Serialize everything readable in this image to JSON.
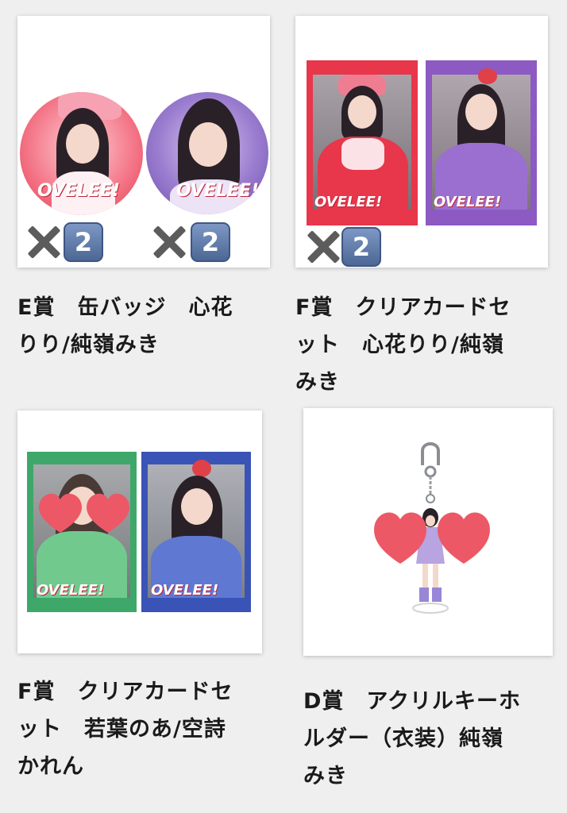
{
  "items": [
    {
      "caption_line1": "E賞　缶バッジ　心花",
      "caption_line2": "りり/純嶺みき",
      "qty_left": "2",
      "qty_right": "2"
    },
    {
      "caption_line1": "F賞　クリアカードセ",
      "caption_line2": "ット　心花りり/純嶺",
      "caption_line3": "みき",
      "qty": "2"
    },
    {
      "caption_line1": "F賞　クリアカードセ",
      "caption_line2": "ット　若葉のあ/空詩",
      "caption_line3": "かれん"
    },
    {
      "caption_line1": "D賞　アクリルキーホ",
      "caption_line2": "ルダー（衣装）純嶺",
      "caption_line3": "みき"
    }
  ],
  "colors": {
    "badge_blue": "#5d78a8",
    "heart_pink": "#ec5866",
    "red_theme": "#e23a4a",
    "purple_theme": "#8e5cc4",
    "green_theme": "#3fa86a",
    "blue_theme": "#3d57b8"
  },
  "icons": {
    "multiply": "heavy-multiplication-x-icon",
    "digit": "keycap-digit-two-icon",
    "heart": "heart-icon"
  }
}
